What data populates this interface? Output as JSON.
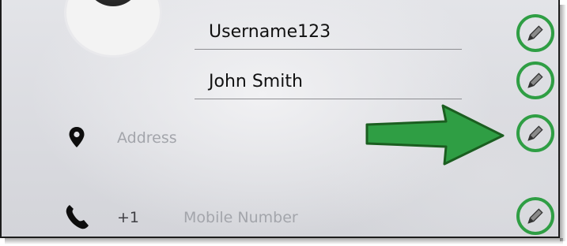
{
  "profile": {
    "username": "Username123",
    "full_name": "John Smith"
  },
  "address": {
    "placeholder": "Address",
    "icon": "location-pin-icon"
  },
  "phone": {
    "prefix": "+1",
    "placeholder": "Mobile Number",
    "icon": "phone-icon"
  },
  "edit_icon": "pencil-icon",
  "colors": {
    "highlight_green": "#2f9e44",
    "arrow_green": "#2f9e44",
    "placeholder_gray": "#a3a5ab"
  }
}
